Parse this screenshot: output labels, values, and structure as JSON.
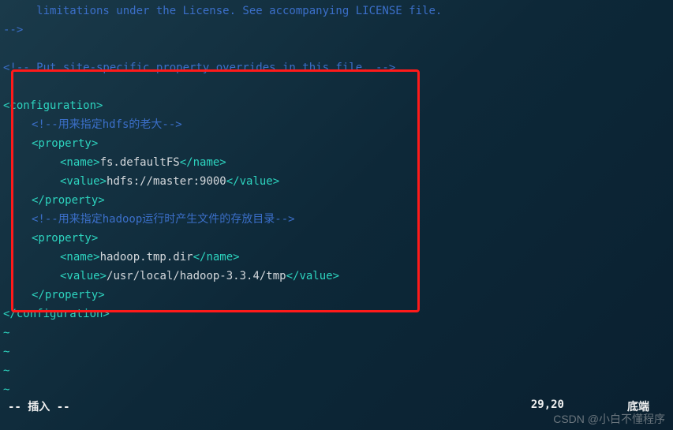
{
  "lines": {
    "l1": "     limitations under the License. See accompanying LICENSE file.",
    "l2": "-->",
    "l4": "<!-- Put site-specific property overrides in this file. -->",
    "cfg_open": "<configuration>",
    "c1": "<!--用来指定hdfs的老大-->",
    "prop_open": "<property>",
    "name_open": "<name>",
    "name1_val": "fs.defaultFS",
    "name_close": "</name>",
    "value_open": "<value>",
    "value1_val": "hdfs://master:9000",
    "value_close": "</value>",
    "prop_close": "</property>",
    "c2": "<!--用来指定hadoop运行时产生文件的存放目录-->",
    "name2_val": "hadoop.tmp.dir",
    "value2_val": "/usr/local/hadoop-3.3.4/tmp",
    "cfg_close": "</configuration>",
    "tilde": "~"
  },
  "status": {
    "mode": "-- 插入 --",
    "position": "29,20",
    "scroll": "底端"
  },
  "watermark": "CSDN @小白不懂程序"
}
